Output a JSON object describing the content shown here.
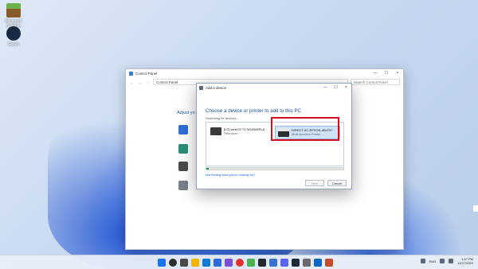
{
  "desktop": {
    "icons": [
      {
        "label": "Microsoft Solitaire",
        "icon": "minecraft-icon"
      },
      {
        "label": "Steam",
        "icon": "steam-icon"
      }
    ]
  },
  "control_panel": {
    "title": "Control Panel",
    "path": "Control Panel",
    "search_placeholder": "Search Control Panel",
    "heading": "Adjust yo"
  },
  "dialog": {
    "title": "Add a device",
    "heading": "Choose a device or printer to add to this PC",
    "status": "Searching for devices...",
    "devices": [
      {
        "name": "[LG] webOS TV 50UN85PLA",
        "type": "Television"
      },
      {
        "name": "DIRECT-9C-EPSON-4B4757",
        "type": "Multi-function Printer"
      }
    ],
    "progress": 0.02,
    "link": "Not finding what you're looking for?",
    "next_label": "Next",
    "cancel_label": "Cancel",
    "close_glyph": "×",
    "min_glyph": "—",
    "max_glyph": "☐"
  },
  "taskbar": {
    "time": "1:47 PM",
    "date": "11/27/2023",
    "lang": "ENG"
  },
  "colors": {
    "highlight": "#d0101f",
    "progress": "#0fa34a",
    "accent": "#1a4f9c"
  }
}
